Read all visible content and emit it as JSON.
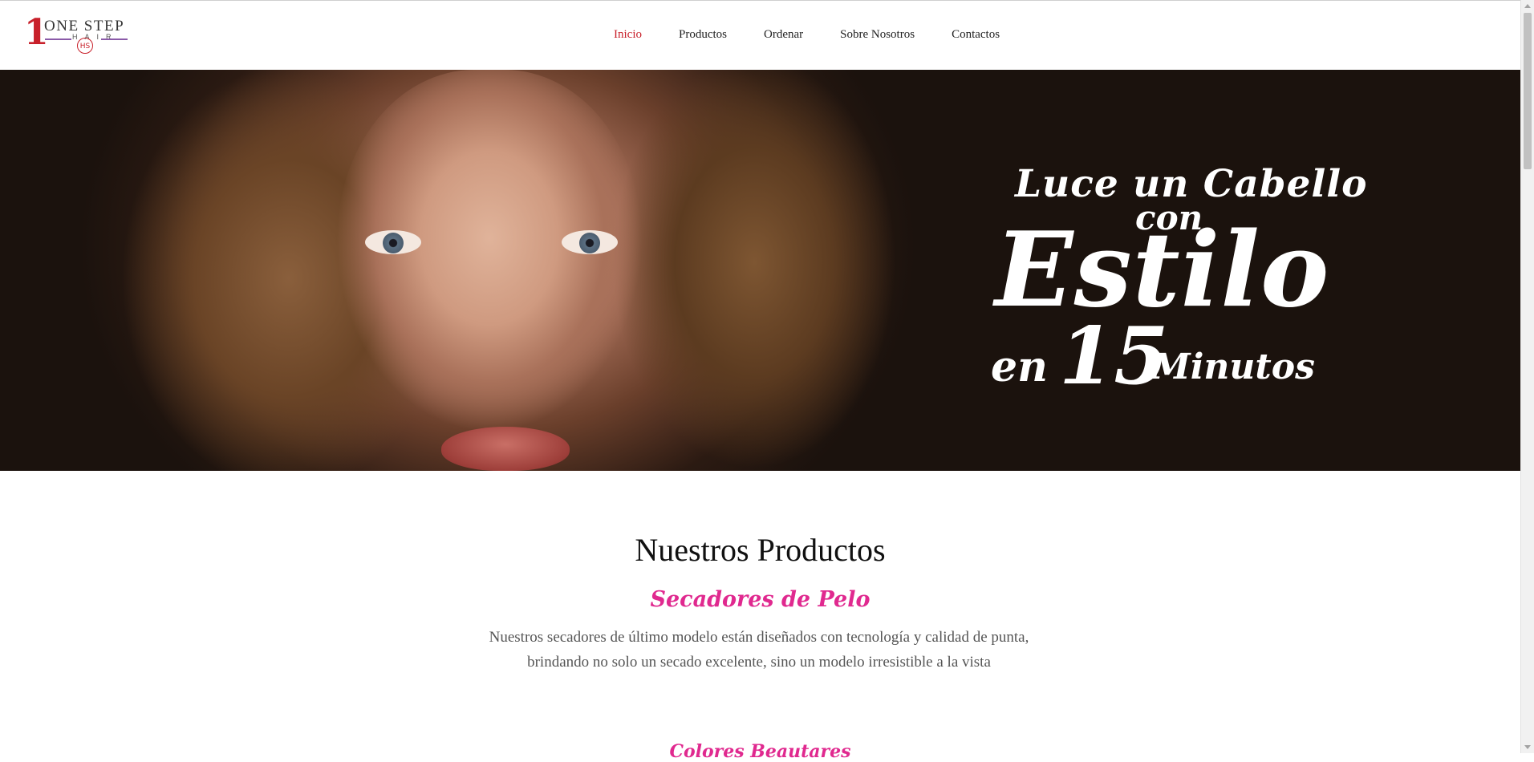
{
  "header": {
    "logo": {
      "numeral": "1",
      "brand": "ONE STEP",
      "sub": "HAIR",
      "mark": "HS"
    },
    "nav": [
      {
        "label": "Inicio",
        "active": true
      },
      {
        "label": "Productos",
        "active": false
      },
      {
        "label": "Ordenar",
        "active": false
      },
      {
        "label": "Sobre Nosotros",
        "active": false
      },
      {
        "label": "Contactos",
        "active": false
      }
    ]
  },
  "hero": {
    "line1": "Luce un Cabello",
    "line2": "con",
    "line3": "Estilo",
    "line4": "en",
    "line5": "15",
    "line6": "Minutos"
  },
  "products": {
    "heading": "Nuestros Productos",
    "items": [
      {
        "title": "Secadores de Pelo",
        "description": "Nuestros secadores de último modelo están diseñados con tecnología y calidad de punta, brindando no solo un secado excelente, sino un modelo irresistible a la vista"
      },
      {
        "title": "Colores Beautares"
      }
    ]
  },
  "colors": {
    "accent_nav": "#c8202a",
    "accent_title": "#e0298f"
  }
}
